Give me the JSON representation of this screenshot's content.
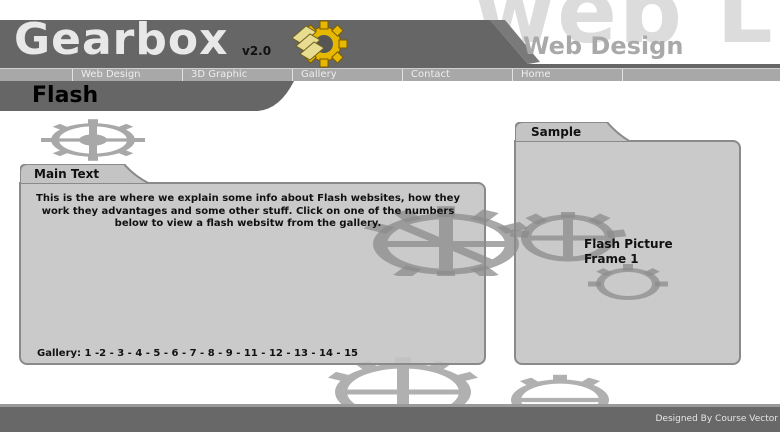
{
  "header": {
    "watermark": "web L",
    "logo": "Gearbox",
    "version": "v2.0",
    "tagline": "Web Design"
  },
  "nav": {
    "items": [
      {
        "label": "Web Design"
      },
      {
        "label": "3D Graphic"
      },
      {
        "label": "Gallery"
      },
      {
        "label": "Contact"
      },
      {
        "label": "Home"
      },
      {
        "label": ""
      }
    ]
  },
  "page": {
    "title": "Flash"
  },
  "main_panel": {
    "label": "Main Text",
    "body": "This is the are where we explain some info about Flash websites, how they work they advantages and some other stuff.  Click on one of the numbers below to view a flash websitw from the gallery.",
    "gallery_label": "Gallery:",
    "gallery_links": [
      "1",
      "2",
      "3",
      "4",
      "5",
      "6",
      "7",
      "8",
      "9",
      "11",
      "12",
      "13",
      "14",
      "15"
    ]
  },
  "sample_panel": {
    "label": "Sample",
    "line1": "Flash Picture",
    "line2": "Frame 1"
  },
  "footer": {
    "credit": "Designed By Course Vector"
  },
  "colors": {
    "header_dark": "#666666",
    "nav_bar": "#a8a8a8",
    "panel_fill": "#c4c4c4",
    "panel_border": "#8a8a8a",
    "gear_gray": "#a0a0a0",
    "logo_gear_gold": "#e6b800"
  }
}
